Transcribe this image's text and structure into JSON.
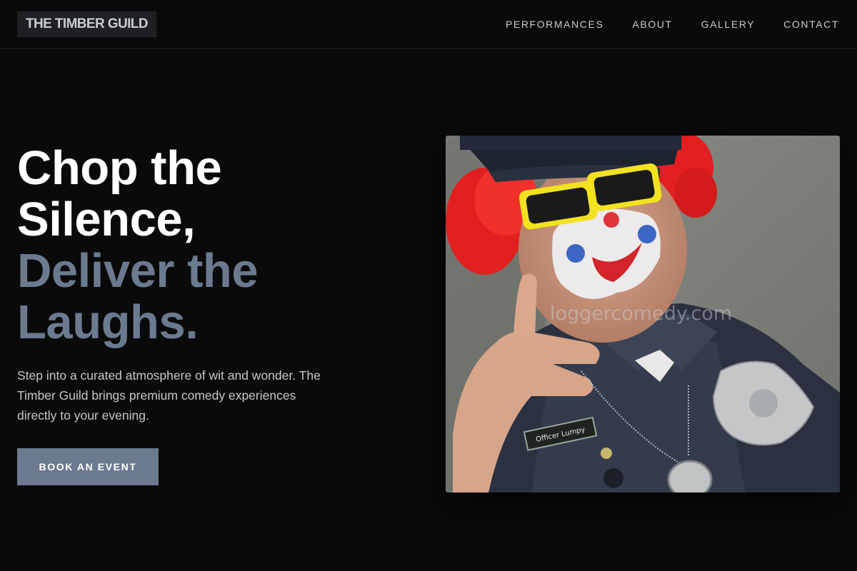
{
  "header": {
    "logo_text": "THE TIMBER GUILD",
    "nav": [
      {
        "label": "PERFORMANCES"
      },
      {
        "label": "ABOUT"
      },
      {
        "label": "GALLERY"
      },
      {
        "label": "CONTACT"
      }
    ]
  },
  "hero": {
    "headline_line1": "Chop the",
    "headline_line2": "Silence,",
    "headline_line3": "Deliver the",
    "headline_line4": "Laughs.",
    "description": "Step into a curated atmosphere of wit and wonder. The Timber Guild brings premium comedy experiences directly to your evening.",
    "cta_label": "BOOK AN EVENT",
    "image": {
      "watermark": "loggercomedy.com",
      "name_tag": "Officer Lumpy"
    }
  },
  "colors": {
    "background": "#0a0a0b",
    "accent": "#6b7a8f",
    "logo_bg": "#1e2024",
    "text_muted": "#c5c8cc"
  }
}
